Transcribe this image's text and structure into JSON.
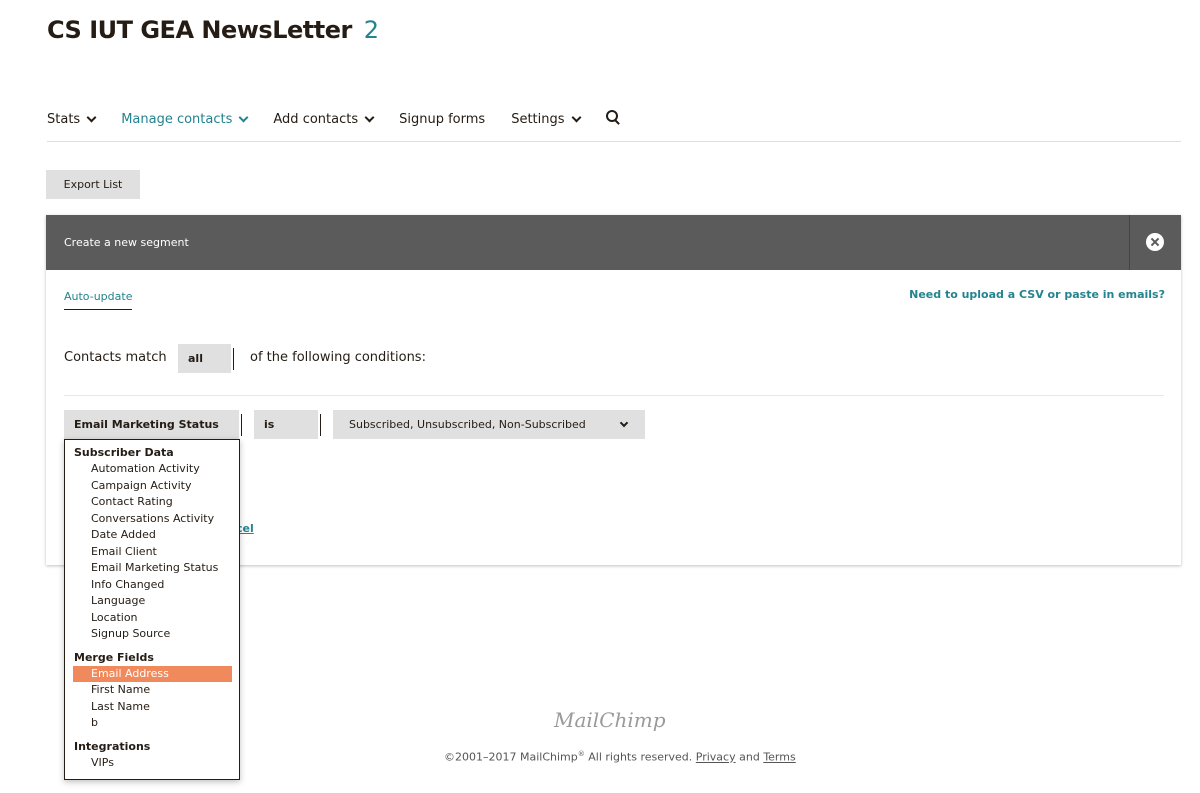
{
  "page": {
    "title": "CS IUT GEA NewsLetter",
    "title_count": "2"
  },
  "nav": {
    "items": [
      {
        "label": "Stats",
        "has_dropdown": true,
        "active": false
      },
      {
        "label": "Manage contacts",
        "has_dropdown": true,
        "active": true
      },
      {
        "label": "Add contacts",
        "has_dropdown": true,
        "active": false
      },
      {
        "label": "Signup forms",
        "has_dropdown": false,
        "active": false
      },
      {
        "label": "Settings",
        "has_dropdown": true,
        "active": false
      }
    ],
    "search_icon": "search-icon"
  },
  "toolbar": {
    "export_label": "Export List"
  },
  "segment": {
    "header_title": "Create a new segment",
    "close_icon": "close-icon",
    "tab_auto_update": "Auto-update",
    "upload_link": "Need to upload a CSV or paste in emails?",
    "match_prefix": "Contacts match",
    "match_value": "all",
    "match_suffix": "of the following conditions:",
    "condition": {
      "field": "Email Marketing Status",
      "operator": "is",
      "value": "Subscribed, Unsubscribed, Non-Subscribed"
    },
    "cancel_partial": "cel"
  },
  "dropdown": {
    "groups": [
      {
        "label": "Subscriber Data",
        "items": [
          "Automation Activity",
          "Campaign Activity",
          "Contact Rating",
          "Conversations Activity",
          "Date Added",
          "Email Client",
          "Email Marketing Status",
          "Info Changed",
          "Language",
          "Location",
          "Signup Source"
        ]
      },
      {
        "label": "Merge Fields",
        "items": [
          "Email Address",
          "First Name",
          "Last Name",
          "b"
        ]
      },
      {
        "label": "Integrations",
        "items": [
          "VIPs"
        ]
      }
    ],
    "selected": "Email Address"
  },
  "footer": {
    "logo": "MailChimp",
    "copyright": "©2001–2017 MailChimp",
    "registered": "®",
    "rights": " All rights reserved. ",
    "privacy": "Privacy",
    "and": " and ",
    "terms": "Terms"
  },
  "colors": {
    "accent": "#23838f",
    "header_bg": "#5b5b5b",
    "highlight": "#f08a5d"
  }
}
